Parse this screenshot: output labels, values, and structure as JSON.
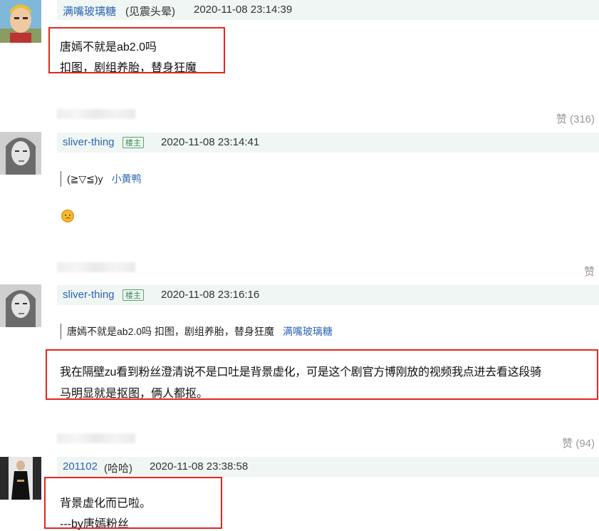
{
  "comments": [
    {
      "user": "满嘴玻璃糖",
      "user_note": "(见震头晕)",
      "time": "2020-11-08 23:14:39",
      "lines": [
        "唐嫣不就是ab2.0吗",
        "扣图，剧组养胎，替身狂魔"
      ],
      "likes": "赞 (316)"
    },
    {
      "user": "sliver-thing",
      "badge": "楼主",
      "time": "2020-11-08 23:14:41",
      "quote_text": "(≧▽≦)y",
      "quote_user": "小黄鸭",
      "likes": "赞"
    },
    {
      "user": "sliver-thing",
      "badge": "楼主",
      "time": "2020-11-08 23:16:16",
      "quote_text": "唐嫣不就是ab2.0吗 扣图，剧组养胎，替身狂魔",
      "quote_user": "满嘴玻璃糖",
      "lines": [
        "我在隔壁zu看到粉丝澄清说不是口吐是背景虚化，可是这个剧官方博刚放的视频我点进去看这段骑",
        "马明显就是抠图，俩人都抠。"
      ],
      "likes": "赞 (94)"
    },
    {
      "user": "201102",
      "user_note": "(哈哈)",
      "time": "2020-11-08 23:38:58",
      "lines": [
        "背景虚化而已啦。",
        "---by唐嫣粉丝"
      ]
    }
  ],
  "emoji_name": "sad-face-emoji"
}
